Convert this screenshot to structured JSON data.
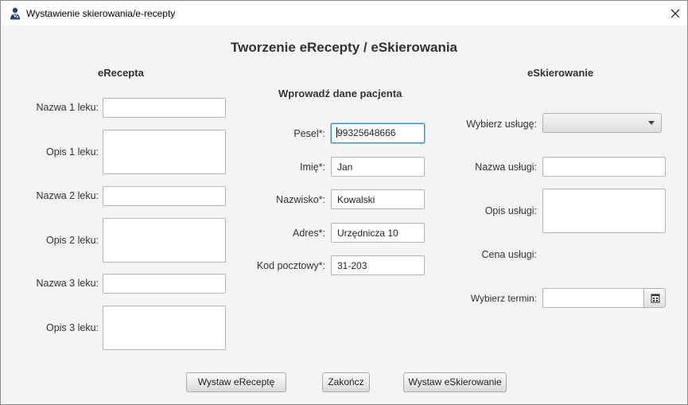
{
  "window": {
    "title": "Wystawienie skierowania/e-recepty",
    "title_icon": "user-doctor-icon"
  },
  "form": {
    "heading": "Tworzenie eRecepty / eSkierowania"
  },
  "erecepta": {
    "title": "eRecepta",
    "drug1_name_label": "Nazwa 1 leku:",
    "drug1_desc_label": "Opis 1 leku:",
    "drug2_name_label": "Nazwa 2 leku:",
    "drug2_desc_label": "Opis 2 leku:",
    "drug3_name_label": "Nazwa 3 leku:",
    "drug3_desc_label": "Opis 3 leku:",
    "drug1_name": "",
    "drug1_desc": "",
    "drug2_name": "",
    "drug2_desc": "",
    "drug3_name": "",
    "drug3_desc": ""
  },
  "patient": {
    "title": "Wprowadź dane pacjenta",
    "pesel_label": "Pesel*:",
    "pesel": "99325648666",
    "first_name_label": "Imię*:",
    "first_name": "Jan",
    "last_name_label": "Nazwisko*:",
    "last_name": "Kowalski",
    "address_label": "Adres*:",
    "address": "Urzędnicza 10",
    "postal_code_label": "Kod pocztowy*:",
    "postal_code": "31-203"
  },
  "eskierowanie": {
    "title": "eSkierowanie",
    "service_select_label": "Wybierz usługę:",
    "service_selected": "",
    "service_name_label": "Nazwa usługi:",
    "service_desc_label": "Opis usługi:",
    "service_price_label": "Cena usługi:",
    "date_label": "Wybierz termin:",
    "service_name": "",
    "service_desc": "",
    "date": ""
  },
  "actions": {
    "issue_erecepta": "Wystaw eReceptę",
    "finish": "Zakończ",
    "issue_eskierowanie": "Wystaw eSkierowanie"
  }
}
